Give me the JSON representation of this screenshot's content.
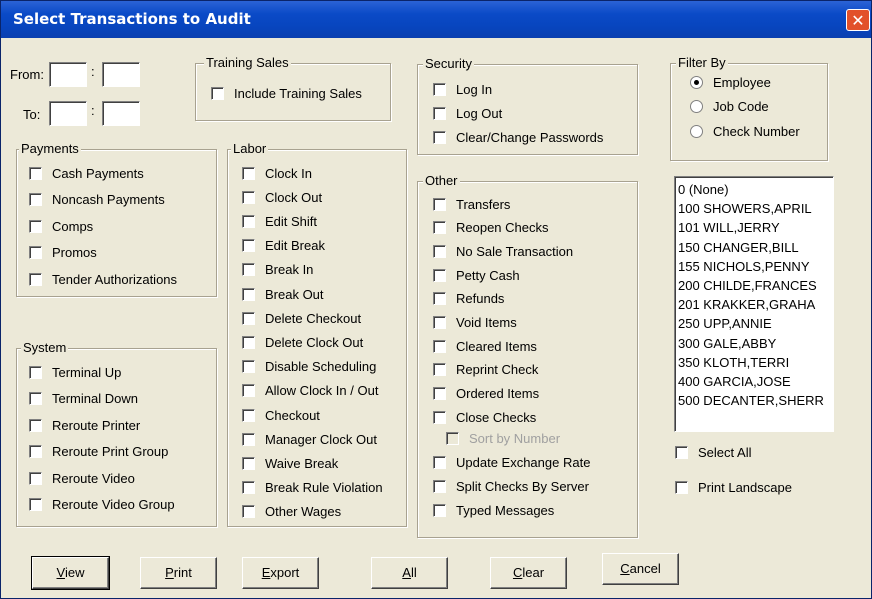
{
  "window": {
    "title": "Select Transactions to Audit",
    "close_glyph": "✕"
  },
  "time_range": {
    "from_label": "From:",
    "to_label": "To:",
    "separator": ":",
    "from_hour": "",
    "from_minute": "",
    "to_hour": "",
    "to_minute": ""
  },
  "training_sales": {
    "title": "Training Sales",
    "include": {
      "label": "Include Training Sales",
      "checked": false
    }
  },
  "security": {
    "title": "Security",
    "items": [
      {
        "label": "Log In",
        "checked": false
      },
      {
        "label": "Log Out",
        "checked": false
      },
      {
        "label": "Clear/Change Passwords",
        "checked": false
      }
    ]
  },
  "filter_by": {
    "title": "Filter By",
    "options": [
      {
        "label": "Employee",
        "selected": true
      },
      {
        "label": "Job Code",
        "selected": false
      },
      {
        "label": "Check Number",
        "selected": false
      }
    ]
  },
  "payments": {
    "title": "Payments",
    "items": [
      {
        "label": "Cash Payments",
        "checked": false
      },
      {
        "label": "Noncash Payments",
        "checked": false
      },
      {
        "label": "Comps",
        "checked": false
      },
      {
        "label": "Promos",
        "checked": false
      },
      {
        "label": "Tender Authorizations",
        "checked": false
      }
    ]
  },
  "labor": {
    "title": "Labor",
    "items": [
      {
        "label": "Clock In",
        "checked": false
      },
      {
        "label": "Clock Out",
        "checked": false
      },
      {
        "label": "Edit Shift",
        "checked": false
      },
      {
        "label": "Edit Break",
        "checked": false
      },
      {
        "label": "Break In",
        "checked": false
      },
      {
        "label": "Break Out",
        "checked": false
      },
      {
        "label": "Delete Checkout",
        "checked": false
      },
      {
        "label": "Delete Clock Out",
        "checked": false
      },
      {
        "label": "Disable Scheduling",
        "checked": false
      },
      {
        "label": "Allow Clock In / Out",
        "checked": false
      },
      {
        "label": "Checkout",
        "checked": false
      },
      {
        "label": "Manager Clock Out",
        "checked": false
      },
      {
        "label": "Waive Break",
        "checked": false
      },
      {
        "label": "Break Rule Violation",
        "checked": false
      },
      {
        "label": "Other Wages",
        "checked": false
      }
    ]
  },
  "system": {
    "title": "System",
    "items": [
      {
        "label": "Terminal Up",
        "checked": false
      },
      {
        "label": "Terminal Down",
        "checked": false
      },
      {
        "label": "Reroute Printer",
        "checked": false
      },
      {
        "label": "Reroute Print Group",
        "checked": false
      },
      {
        "label": "Reroute Video",
        "checked": false
      },
      {
        "label": "Reroute Video Group",
        "checked": false
      }
    ]
  },
  "other": {
    "title": "Other",
    "items": [
      {
        "label": "Transfers",
        "checked": false
      },
      {
        "label": "Reopen Checks",
        "checked": false
      },
      {
        "label": "No Sale Transaction",
        "checked": false
      },
      {
        "label": "Petty Cash",
        "checked": false
      },
      {
        "label": "Refunds",
        "checked": false
      },
      {
        "label": "Void Items",
        "checked": false
      },
      {
        "label": "Cleared Items",
        "checked": false
      },
      {
        "label": "Reprint Check",
        "checked": false
      },
      {
        "label": "Ordered Items",
        "checked": false
      },
      {
        "label": "Close Checks",
        "checked": false
      },
      {
        "label": "Sort by Number",
        "checked": false,
        "disabled": true
      },
      {
        "label": "Update Exchange Rate",
        "checked": false
      },
      {
        "label": "Split Checks By Server",
        "checked": false
      },
      {
        "label": "Typed Messages",
        "checked": false
      }
    ]
  },
  "employees": [
    "0 (None)",
    "100 SHOWERS,APRIL",
    "101 WILL,JERRY",
    "150 CHANGER,BILL",
    "155 NICHOLS,PENNY",
    "200 CHILDE,FRANCES",
    "201 KRAKKER,GRAHA",
    "250 UPP,ANNIE",
    "300 GALE,ABBY",
    "350 KLOTH,TERRI",
    "400 GARCIA,JOSE",
    "500 DECANTER,SHERR"
  ],
  "options": {
    "select_all": {
      "label": "Select All",
      "checked": false
    },
    "print_landscape": {
      "label": "Print Landscape",
      "checked": false
    }
  },
  "buttons": {
    "view": {
      "mnemonic": "V",
      "rest": "iew"
    },
    "print": {
      "mnemonic": "P",
      "rest": "rint"
    },
    "export": {
      "mnemonic": "E",
      "rest": "xport"
    },
    "all": {
      "mnemonic": "A",
      "rest": "ll"
    },
    "clear": {
      "mnemonic": "C",
      "rest": "lear"
    },
    "cancel": {
      "mnemonic": "C",
      "rest": "ancel"
    }
  }
}
